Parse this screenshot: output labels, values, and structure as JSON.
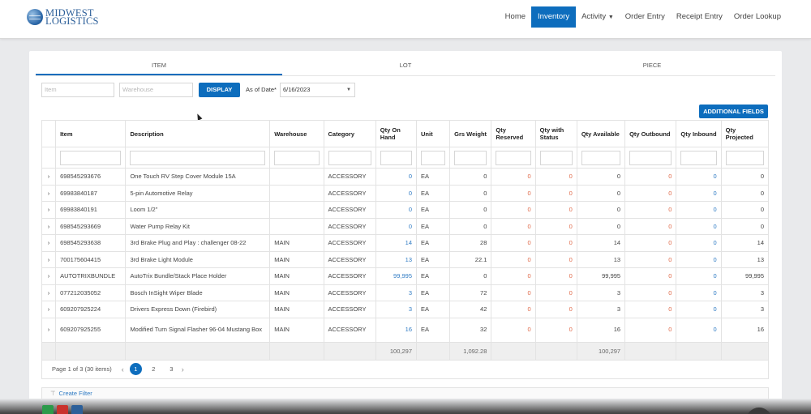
{
  "brand": {
    "line1": "MIDWEST",
    "line2": "LOGISTICS"
  },
  "nav": {
    "home": "Home",
    "inventory": "Inventory",
    "activity": "Activity",
    "order_entry": "Order Entry",
    "receipt_entry": "Receipt Entry",
    "order_lookup": "Order Lookup"
  },
  "tabs": {
    "item": "ITEM",
    "lot": "LOT",
    "piece": "PIECE"
  },
  "search": {
    "item_placeholder": "Item",
    "warehouse_placeholder": "Warehouse",
    "display_label": "DISPLAY",
    "as_of_label": "As of Date*",
    "as_of_value": "6/16/2023"
  },
  "additional_fields_label": "ADDITIONAL FIELDS",
  "columns": {
    "item": "Item",
    "description": "Description",
    "warehouse": "Warehouse",
    "category": "Category",
    "qty_on_hand": "Qty On Hand",
    "unit": "Unit",
    "grs_weight": "Grs Weight",
    "qty_reserved": "Qty Reserved",
    "qty_with_status": "Qty with Status",
    "qty_available": "Qty Available",
    "qty_outbound": "Qty Outbound",
    "qty_inbound": "Qty Inbound",
    "qty_projected": "Qty Projected"
  },
  "rows": [
    {
      "item": "698545293676",
      "description": "One Touch RV Step Cover Module 15A",
      "warehouse": "",
      "category": "ACCESSORY",
      "on_hand": "0",
      "unit": "EA",
      "weight": "0",
      "reserved": "0",
      "status": "0",
      "available": "0",
      "outbound": "0",
      "inbound": "0",
      "projected": "0"
    },
    {
      "item": "69983840187",
      "description": "5-pin Automotive Relay",
      "warehouse": "",
      "category": "ACCESSORY",
      "on_hand": "0",
      "unit": "EA",
      "weight": "0",
      "reserved": "0",
      "status": "0",
      "available": "0",
      "outbound": "0",
      "inbound": "0",
      "projected": "0"
    },
    {
      "item": "69983840191",
      "description": "Loom 1/2\"",
      "warehouse": "",
      "category": "ACCESSORY",
      "on_hand": "0",
      "unit": "EA",
      "weight": "0",
      "reserved": "0",
      "status": "0",
      "available": "0",
      "outbound": "0",
      "inbound": "0",
      "projected": "0"
    },
    {
      "item": "698545293669",
      "description": "Water Pump Relay Kit",
      "warehouse": "",
      "category": "ACCESSORY",
      "on_hand": "0",
      "unit": "EA",
      "weight": "0",
      "reserved": "0",
      "status": "0",
      "available": "0",
      "outbound": "0",
      "inbound": "0",
      "projected": "0"
    },
    {
      "item": "698545293638",
      "description": "3rd Brake Plug and Play : challenger 08-22",
      "warehouse": "MAIN",
      "category": "ACCESSORY",
      "on_hand": "14",
      "unit": "EA",
      "weight": "28",
      "reserved": "0",
      "status": "0",
      "available": "14",
      "outbound": "0",
      "inbound": "0",
      "projected": "14"
    },
    {
      "item": "700175604415",
      "description": "3rd Brake Light Module",
      "warehouse": "MAIN",
      "category": "ACCESSORY",
      "on_hand": "13",
      "unit": "EA",
      "weight": "22.1",
      "reserved": "0",
      "status": "0",
      "available": "13",
      "outbound": "0",
      "inbound": "0",
      "projected": "13"
    },
    {
      "item": "AUTOTRIXBUNDLE",
      "description": "AutoTrix Bundle/Stack Place Holder",
      "warehouse": "MAIN",
      "category": "ACCESSORY",
      "on_hand": "99,995",
      "unit": "EA",
      "weight": "0",
      "reserved": "0",
      "status": "0",
      "available": "99,995",
      "outbound": "0",
      "inbound": "0",
      "projected": "99,995"
    },
    {
      "item": "077212035052",
      "description": "Bosch InSight Wiper Blade",
      "warehouse": "MAIN",
      "category": "ACCESSORY",
      "on_hand": "3",
      "unit": "EA",
      "weight": "72",
      "reserved": "0",
      "status": "0",
      "available": "3",
      "outbound": "0",
      "inbound": "0",
      "projected": "3"
    },
    {
      "item": "609207925224",
      "description": "Drivers Express Down (Firebird)",
      "warehouse": "MAIN",
      "category": "ACCESSORY",
      "on_hand": "3",
      "unit": "EA",
      "weight": "42",
      "reserved": "0",
      "status": "0",
      "available": "3",
      "outbound": "0",
      "inbound": "0",
      "projected": "3"
    },
    {
      "item": "609207925255",
      "description": "Modified Turn Signal Flasher 96-04 Mustang Box",
      "warehouse": "MAIN",
      "category": "ACCESSORY",
      "on_hand": "16",
      "unit": "EA",
      "weight": "32",
      "reserved": "0",
      "status": "0",
      "available": "16",
      "outbound": "0",
      "inbound": "0",
      "projected": "16"
    }
  ],
  "totals": {
    "on_hand": "100,297",
    "weight": "1,092.28",
    "available": "100,297"
  },
  "pager": {
    "info": "Page 1 of 3 (30 items)",
    "pages": [
      "1",
      "2",
      "3"
    ],
    "prev": "‹",
    "next": "›"
  },
  "create_filter_label": "Create Filter",
  "colors": {
    "accent": "#0d6dbd",
    "link": "#2f7bc4",
    "alert": "#e06a4a"
  }
}
